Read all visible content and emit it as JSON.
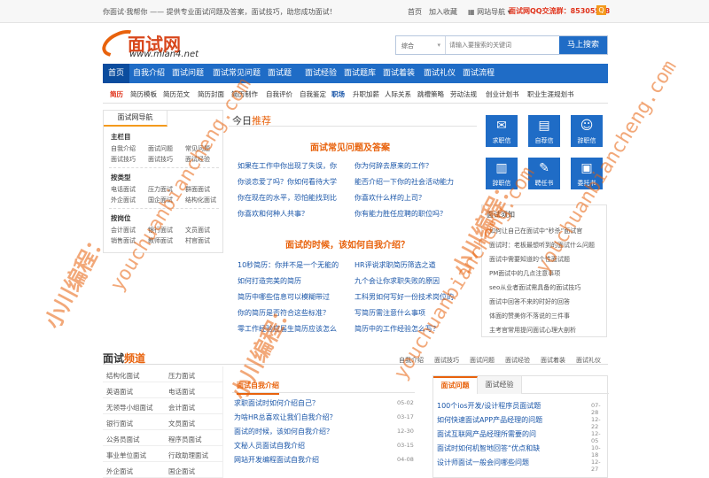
{
  "topbar": {
    "tagline": "你面试·我帮你 —— 提供专业面试问题及答案，面试技巧，助您成功面试！",
    "home": "首页",
    "favorite": "加入收藏",
    "sitenav": "网站导航",
    "qq_label": "面试网QQ交流群：85305518",
    "qq_badge": "Q"
  },
  "logo": {
    "name": "面试网",
    "domain": "www.mian4.net"
  },
  "search": {
    "category": "综合",
    "placeholder": "请输入要搜索的关键词",
    "button": "马上搜索"
  },
  "mainnav": [
    "首页",
    "自我介绍",
    "面试问题",
    "面试常见问题",
    "面试题",
    "面试经验",
    "面试题库",
    "面试着装",
    "面试礼仪",
    "面试流程"
  ],
  "subnav": [
    "简历",
    "简历模板",
    "简历范文",
    "简历封面",
    "简历制作",
    "自我评价",
    "自我鉴定",
    "职场",
    "升职加薪",
    "人际关系",
    "跳槽策略",
    "劳动法规",
    "创业计划书",
    "职业生涯规划书"
  ],
  "sidebar": {
    "tab": "面试网导航",
    "sections": [
      {
        "title": "主栏目",
        "links": [
          "自我介绍",
          "面试问题",
          "常见问题",
          "面试技巧",
          "面试技巧",
          "面试经验"
        ]
      },
      {
        "title": "按类型",
        "links": [
          "电话面试",
          "压力面试",
          "群面面试",
          "外企面试",
          "国企面试",
          "结构化面试"
        ]
      },
      {
        "title": "按岗位",
        "links": [
          "会计面试",
          "银行面试",
          "文员面试",
          "销售面试",
          "教师面试",
          "村官面试"
        ]
      }
    ]
  },
  "today": {
    "prefix": "今日",
    "highlight": "推荐"
  },
  "sec1": {
    "title": "面试常见问题及答案",
    "left": [
      "如果在工作中你出现了失误，你",
      "你谈恋爱了吗？你如何看待大学",
      "你在现在的水平，恐怕能找到比",
      "你喜欢和何种人共事？"
    ],
    "right": [
      "你为何辞去原来的工作？",
      "能否介绍一下你的社会活动能力",
      "你喜欢什么样的上司？",
      "你有能力胜任应聘的职位吗？"
    ]
  },
  "sec2": {
    "title": "面试的时候，该如何自我介绍？",
    "left": [
      "10秒简历：你并不是一个无能的",
      "如何打造完美的简历",
      "简历中哪些信息可以模糊带过",
      "你的简历是否符合这些标准？",
      "零工作经验应届生简历应该怎么"
    ],
    "right": [
      "HR评说求职简历筛选之道",
      "九个会让你求职失败的原因",
      "工科男如何写好一份技术岗位的",
      "写简历需注意什么事项",
      "简历中的工作经验怎么写？"
    ]
  },
  "icons": [
    {
      "label": "求职信",
      "icon": "mail-icon"
    },
    {
      "label": "自荐信",
      "icon": "document-icon"
    },
    {
      "label": "辞职信",
      "icon": "user-icon"
    },
    {
      "label": "辞职信",
      "icon": "document-icon"
    },
    {
      "label": "聘任书",
      "icon": "certificate-icon"
    },
    {
      "label": "委托书",
      "icon": "book-icon"
    }
  ],
  "news": {
    "title": "面试须知",
    "items": [
      "如何让自己在面试中“秒杀”面试官",
      "面试时：老板最想听到的面试什么问题",
      "面试中需要知道的个性面试题",
      "PM面试中的几点注意事项",
      "seo从业者面试需具备的面试技巧",
      "面试中回答不来的时好的回答",
      "体面的赞美你不落说的三件事",
      "主考官常用提问面试心理大剖析"
    ]
  },
  "channel": {
    "prefix": "面试",
    "highlight": "频道",
    "tabs": [
      "自我介绍",
      "面试技巧",
      "面试问题",
      "面试经验",
      "面试着装",
      "面试礼仪"
    ]
  },
  "grid": [
    [
      "结构化面试",
      "压力面试"
    ],
    [
      "英语面试",
      "电话面试"
    ],
    [
      "无领导小组面试",
      "会计面试"
    ],
    [
      "银行面试",
      "文员面试"
    ],
    [
      "公务员面试",
      "程序员面试"
    ],
    [
      "事业单位面试",
      "行政助理面试"
    ],
    [
      "外企面试",
      "国企面试"
    ]
  ],
  "box2": {
    "title": "面试自我介绍",
    "items": [
      {
        "t": "求职面试时如何介绍自己？",
        "d": "05-02"
      },
      {
        "t": "为啥HR总喜欢让我们自我介绍？",
        "d": "03-17"
      },
      {
        "t": "面试的时候，该如何自我介绍？",
        "d": "12-30"
      },
      {
        "t": "文秘人员面试自我介绍",
        "d": "03-15"
      },
      {
        "t": "网站开发编程面试自我介绍",
        "d": "04-08"
      }
    ]
  },
  "box3": {
    "tab1": "面试问题",
    "tab2": "面试经验",
    "items": [
      {
        "t": "100个ios开发/设计程序员面试题",
        "d": "07-28"
      },
      {
        "t": "如何快速面试APP产品经理的问题",
        "d": "12-22"
      },
      {
        "t": "面试互联网产品经理所需要的问",
        "d": "12-05"
      },
      {
        "t": "面试时如何机智地回答“优点和缺",
        "d": "10-18"
      },
      {
        "t": "设计师面试一般会问哪些问题",
        "d": "12-27"
      }
    ]
  },
  "watermarks": {
    "cn": "小川编程：",
    "site": "youchuanbiancheng.com"
  }
}
